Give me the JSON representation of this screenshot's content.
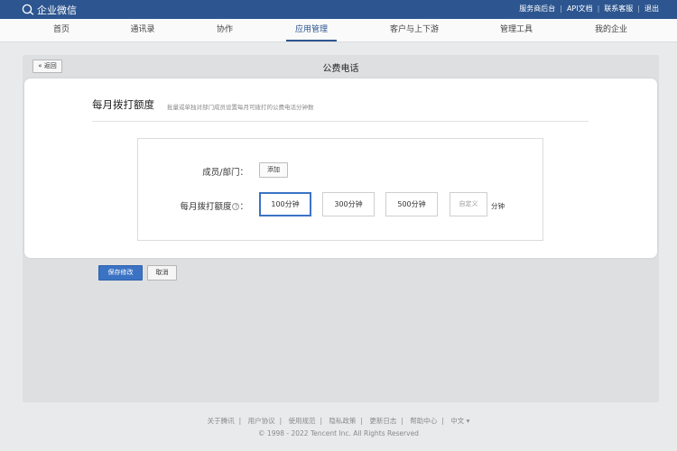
{
  "app": {
    "logo_text": "企业微信"
  },
  "toplinks": [
    "服务商后台",
    "API文档",
    "联系客服",
    "退出"
  ],
  "nav": [
    {
      "label": "首页",
      "active": false
    },
    {
      "label": "通讯录",
      "active": false
    },
    {
      "label": "协作",
      "active": false
    },
    {
      "label": "应用管理",
      "active": true
    },
    {
      "label": "客户与上下游",
      "active": false
    },
    {
      "label": "管理工具",
      "active": false
    },
    {
      "label": "我的企业",
      "active": false
    }
  ],
  "panel": {
    "back_label": "« 返回",
    "title": "公费电话"
  },
  "section": {
    "title": "每月拨打额度",
    "description": "批量或单独对部门成员设置每月可拨打的公费电话分钟数"
  },
  "form": {
    "member_label": "成员/部门：",
    "add_button": "添加",
    "quota_label": "每月拨打额度",
    "quota_suffix": "：",
    "help_glyph": "?",
    "options": [
      "100分钟",
      "300分钟",
      "500分钟"
    ],
    "selected_option": "100分钟",
    "custom_placeholder": "自定义",
    "unit": "分钟"
  },
  "actions": {
    "save": "保存修改",
    "cancel": "取消"
  },
  "footer": {
    "links": [
      "关于腾讯",
      "用户协议",
      "使用规范",
      "隐私政策",
      "更新日志",
      "帮助中心",
      "中文 ▾"
    ],
    "copyright": "© 1998 - 2022 Tencent Inc. All Rights Reserved"
  },
  "colors": {
    "header": "#2d5690",
    "primary": "#3b73c4",
    "page_bg": "#e9eaec"
  }
}
